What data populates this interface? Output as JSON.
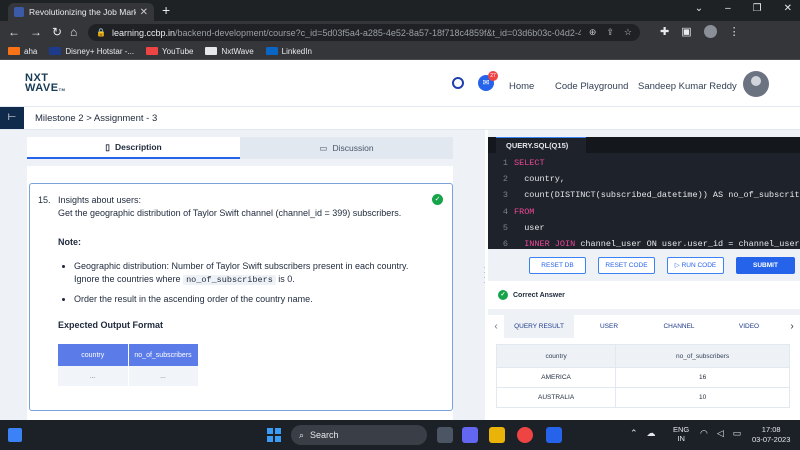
{
  "browser": {
    "tab_title": "Revolutionizing the Job Market | N",
    "url_domain": "learning.ccbp.in",
    "url_path": "/backend-development/course?c_id=5d03f5a4-a285-4e52-8a57-18f718c4859f&t_id=03d6b03c-04d2-4580-903e-a2a...",
    "bookmarks": [
      {
        "label": "aha",
        "color": "#f97316"
      },
      {
        "label": "Disney+ Hotstar -...",
        "color": "#1e3a8a"
      },
      {
        "label": "YouTube",
        "color": "#ef4444"
      },
      {
        "label": "NxtWave",
        "color": "#e5e7eb"
      },
      {
        "label": "LinkedIn",
        "color": "#0a66c2"
      }
    ]
  },
  "header": {
    "logo_line1": "NXT",
    "logo_line2": "WAVE",
    "logo_suffix": "TM",
    "notification_count": "27",
    "nav": {
      "home": "Home",
      "playground": "Code Playground"
    },
    "user_name": "Sandeep Kumar Reddy"
  },
  "breadcrumb": "Milestone 2 > Assignment - 3",
  "left_tabs": {
    "description": "Description",
    "discussion": "Discussion"
  },
  "question": {
    "number": "15.",
    "title": "Insights about users:",
    "description": "Get the geographic distribution of Taylor Swift channel (channel_id = 399) subscribers.",
    "note_label": "Note:",
    "bullet1_a": "Geographic distribution: Number of Taylor Swift subscribers present in each country. Ignore the countries where ",
    "bullet1_code": "no_of_subscribers",
    "bullet1_b": " is 0.",
    "bullet2": "Order the result in the ascending order of the country name.",
    "expected_label": "Expected Output Format",
    "expected_headers": [
      "country",
      "no_of_subscribers"
    ],
    "expected_rows": [
      "...",
      "..."
    ]
  },
  "editor": {
    "tab": "QUERY.SQL(Q15)",
    "lines": [
      {
        "n": "1",
        "kw": "SELECT",
        "tx": ""
      },
      {
        "n": "2",
        "kw": "",
        "tx": "  country,"
      },
      {
        "n": "3",
        "kw": "",
        "tx": "  count(DISTINCT(subscribed_datetime)) AS no_of_subscrit"
      },
      {
        "n": "4",
        "kw": "FROM",
        "tx": ""
      },
      {
        "n": "5",
        "kw": "",
        "tx": "  user"
      },
      {
        "n": "6",
        "kw": "  INNER JOIN",
        "tx": " channel_user ON user.user_id = channel_user"
      }
    ]
  },
  "buttons": {
    "reset_db": "RESET DB",
    "reset_code": "RESET CODE",
    "run_code": "RUN CODE",
    "submit": "SUBMIT"
  },
  "result_status": "Correct Answer",
  "result_tabs": [
    "QUERY RESULT",
    "USER",
    "CHANNEL",
    "VIDEO"
  ],
  "result_table": {
    "headers": [
      "country",
      "no_of_subscribers"
    ],
    "rows": [
      [
        "AMERICA",
        "16"
      ],
      [
        "AUSTRALIA",
        "10"
      ]
    ]
  },
  "taskbar": {
    "search": "Search",
    "lang_line1": "ENG",
    "lang_line2": "IN",
    "time": "17:08",
    "date": "03-07-2023"
  }
}
